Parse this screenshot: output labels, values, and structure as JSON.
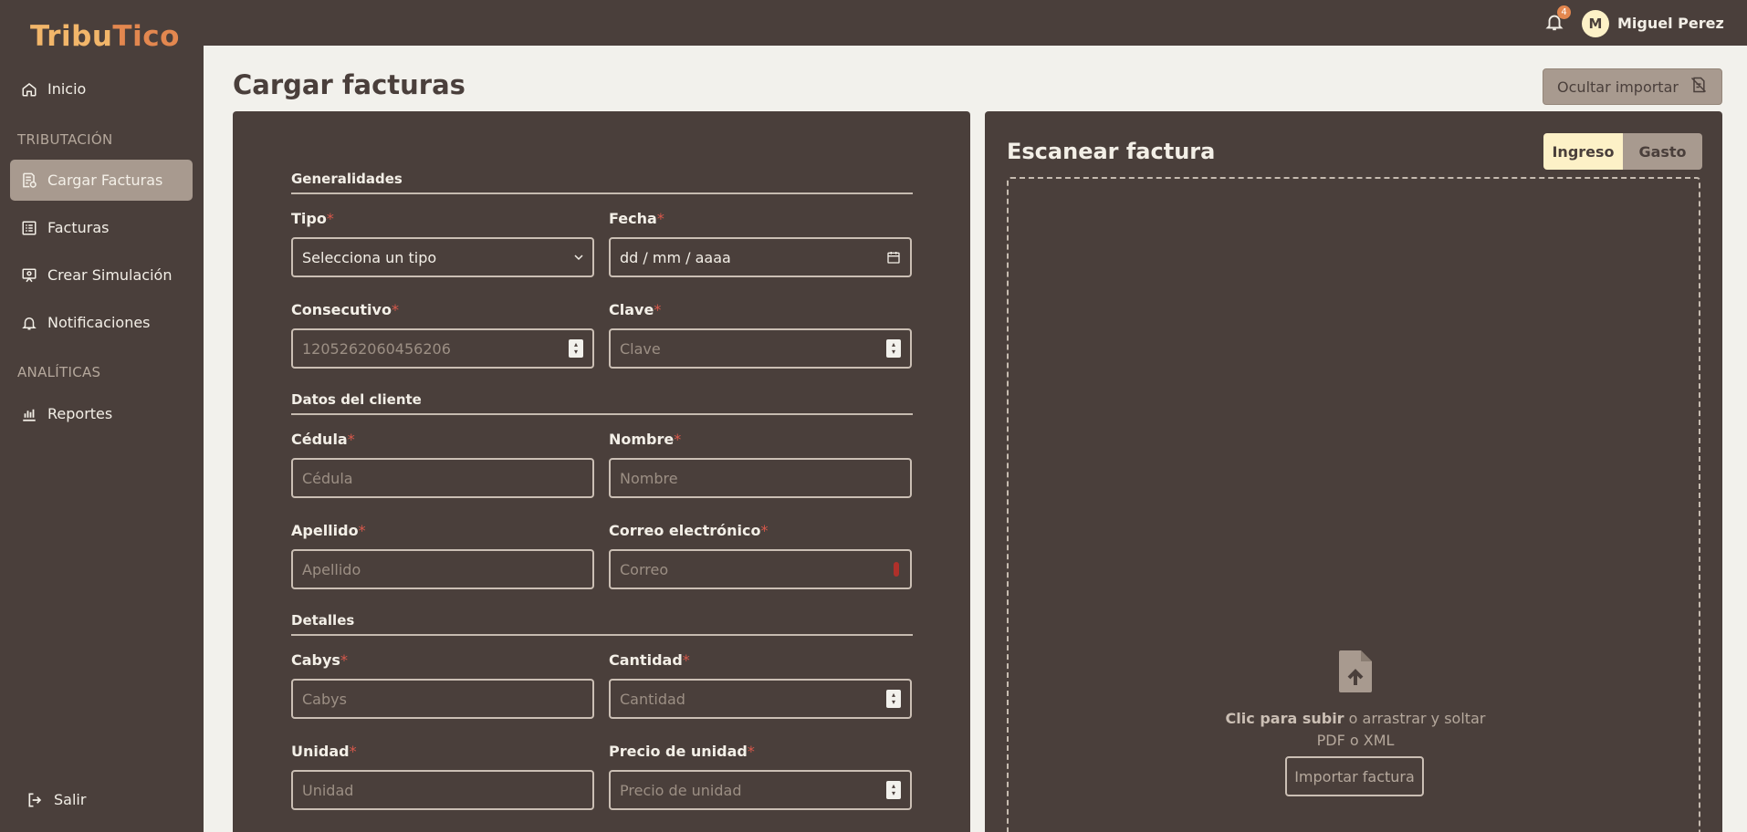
{
  "app": {
    "logo_part1": "Tribu",
    "logo_part2": "Tico",
    "accent": "#e3874f",
    "bg_dark": "#4a3f3b"
  },
  "sidebar": {
    "items": [
      {
        "label": "Inicio",
        "icon": "home-icon"
      },
      {
        "label": "Cargar Facturas",
        "icon": "invoice-upload-icon",
        "active": true
      },
      {
        "label": "Facturas",
        "icon": "list-icon"
      },
      {
        "label": "Crear Simulación",
        "icon": "simulation-icon"
      },
      {
        "label": "Notificaciones",
        "icon": "bell-icon"
      },
      {
        "label": "Reportes",
        "icon": "bar-chart-icon"
      }
    ],
    "sections": {
      "tributacion": "TRIBUTACIÓN",
      "analiticas": "ANALÍTICAS"
    },
    "logout": "Salir"
  },
  "topbar": {
    "notification_count": "4",
    "avatar_initial": "M",
    "username": "Miguel Perez"
  },
  "main": {
    "title": "Cargar facturas",
    "hide_import_label": "Ocultar importar"
  },
  "form": {
    "groups": {
      "general": "Generalidades",
      "client": "Datos del cliente",
      "details": "Detalles"
    },
    "fields": {
      "tipo": {
        "label": "Tipo",
        "value": "Selecciona un tipo"
      },
      "fecha": {
        "label": "Fecha",
        "value": "dd / mm / aaaa"
      },
      "consecutivo": {
        "label": "Consecutivo",
        "placeholder": "1205262060456206"
      },
      "clave": {
        "label": "Clave",
        "placeholder": "Clave"
      },
      "cedula": {
        "label": "Cédula",
        "placeholder": "Cédula"
      },
      "nombre": {
        "label": "Nombre",
        "placeholder": "Nombre"
      },
      "apellido": {
        "label": "Apellido",
        "placeholder": "Apellido"
      },
      "correo": {
        "label": "Correo electrónico",
        "placeholder": "Correo"
      },
      "cabys": {
        "label": "Cabys",
        "placeholder": "Cabys"
      },
      "cantidad": {
        "label": "Cantidad",
        "placeholder": "Cantidad"
      },
      "unidad": {
        "label": "Unidad",
        "placeholder": "Unidad"
      },
      "precio": {
        "label": "Precio de unidad",
        "placeholder": "Precio de unidad"
      }
    },
    "required_mark": "*"
  },
  "scan": {
    "title": "Escanear factura",
    "toggle": {
      "on": "Ingreso",
      "off": "Gasto"
    },
    "upload_bold": "Clic para subir",
    "upload_rest": " o arrastrar y soltar",
    "upload_formats": "PDF o XML",
    "import_button": "Importar factura"
  }
}
